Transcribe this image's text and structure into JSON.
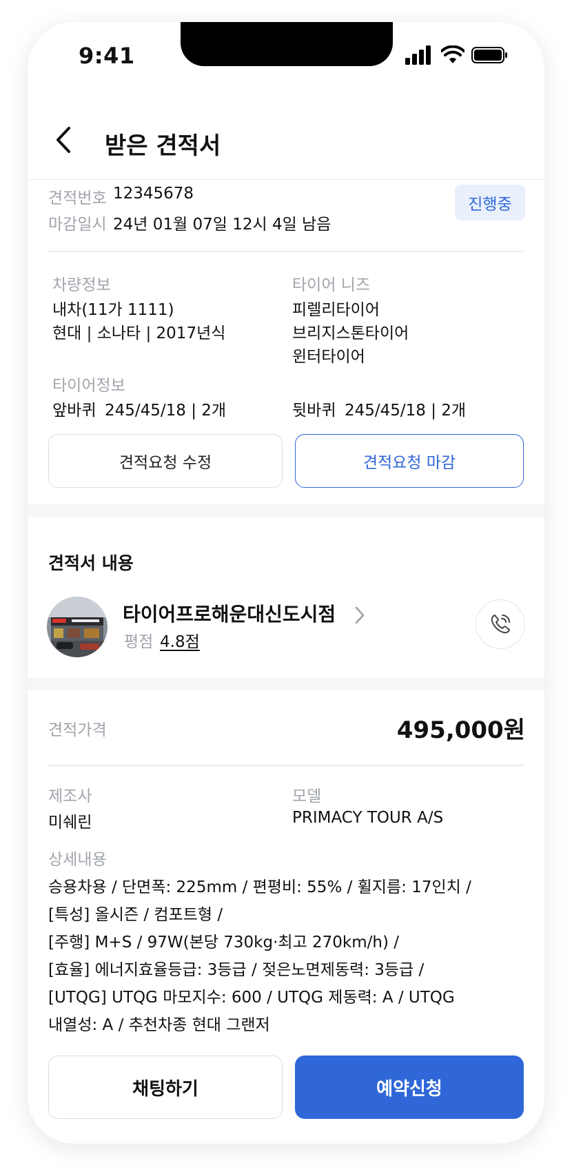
{
  "status_bar": {
    "time": "9:41"
  },
  "header": {
    "title": "받은 견적서"
  },
  "quote_info": {
    "number_label": "견적번호",
    "number_value": "12345678",
    "deadline_label": "마감일시",
    "deadline_value": "24년 01월 07일 12시 4일 남음",
    "status_badge": "진행중"
  },
  "vehicle": {
    "label": "차량정보",
    "line1": "내차(11가 1111)",
    "line2": "현대 | 소나타 | 2017년식"
  },
  "tire_needs": {
    "label": "타이어 니즈",
    "items": [
      "피렐리타이어",
      "브리지스톤타이어",
      "윈터타이어"
    ]
  },
  "tire_info": {
    "label": "타이어정보",
    "front_label": "앞바퀴",
    "front_value": "245/45/18 | 2개",
    "rear_label": "뒷바퀴",
    "rear_value": "245/45/18 | 2개"
  },
  "actions": {
    "edit_label": "견적요청 수정",
    "close_label": "견적요청 마감"
  },
  "quote_content": {
    "title": "견적서 내용",
    "shop_name": "타이어프로해운대신도시점",
    "rating_label": "평점",
    "rating_value": "4.8점"
  },
  "price": {
    "label": "견적가격",
    "value": "495,000원"
  },
  "product": {
    "maker_label": "제조사",
    "maker_value": "미쉐린",
    "model_label": "모델",
    "model_value": "PRIMACY TOUR A/S",
    "detail_label": "상세내용",
    "detail_lines": [
      "승용차용 / 단면폭: 225mm / 편평비: 55% / 휠지름: 17인치 /",
      "[특성] 올시즌 / 컴포트형 /",
      "[주행] M+S / 97W(본당 730kg·최고 270km/h) /",
      "[효율] 에너지효율등급: 3등급 / 젖은노면제동력: 3등급 /",
      "[UTQG] UTQG 마모지수: 600 / UTQG 제동력: A / UTQG",
      "내열성: A / 추천차종 현대 그랜저"
    ]
  },
  "footer": {
    "chat_label": "채팅하기",
    "reserve_label": "예약신청"
  },
  "colors": {
    "accent": "#2f67d8",
    "badge_bg": "#e9f0fc",
    "muted_text": "#a0a4ab",
    "section_gap": "#f5f6f8"
  }
}
